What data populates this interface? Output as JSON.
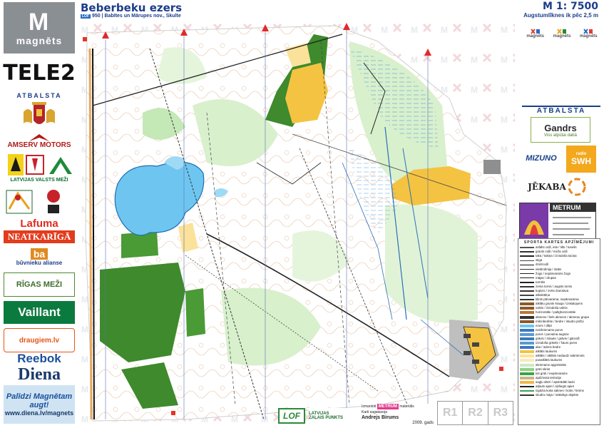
{
  "header": {
    "title": "Beberbeku ezers",
    "badge": "LOF",
    "subtitle": "950 | Babītes un Mārupes nov., Skulte",
    "scale": "M 1: 7500",
    "contour": "Augstumlīknes ik pēc 2,5 m"
  },
  "left_sponsors": {
    "magnets_mark": "M",
    "magnets_name": "magnēts",
    "tele2": "TELE2",
    "atbalsta": "ATBALSTA",
    "amserv": "AMSERV MOTORS",
    "lvm": "LATVIJAS VALSTS MEŽI",
    "lafuma": "Lafuma",
    "neatkariga": "NEATKARĪGĀ",
    "buvnieku_mark": "ba",
    "buvnieku": "būvnieku alianse",
    "rigas_mezi": "RĪGAS MEŽI",
    "vaillant": "Vaillant",
    "draugiem": "draugiem.lv",
    "reebok": "Reebok",
    "diena": "Diena",
    "palidzi": "Palīdzi Magnētam augt!",
    "palidzi_url": "www.diena.lv/magnets"
  },
  "right_sponsors": {
    "magnets_small": [
      "magnēts",
      "magnēts",
      "magnēts"
    ],
    "atbalsta": "ATBALSTA",
    "gandrs": "Gandrs",
    "gandrs_sub": "Viss atpūtai dabā",
    "mizuno": "MIZUNO",
    "swh": "SWH",
    "swh_radio": "radio",
    "jekaba": "JĒKABA",
    "metrum": "METRUM"
  },
  "legend": {
    "title": "SPORTA KARTES APZĪMĒJUMI",
    "items": [
      {
        "label": "asfalts ceļš, iela / tilts / tunelis",
        "color": "#555555"
      },
      {
        "label": "grants ceļš / meža ceļš",
        "color": "#333333"
      },
      {
        "label": "taka / takiņa / izzūdoša taciņa",
        "color": "#222222"
      },
      {
        "label": "stiga",
        "color": "#444444"
      },
      {
        "label": "dzelzceļš",
        "color": "#111111"
      },
      {
        "label": "elektrolīnija / stabs",
        "color": "#333333"
      },
      {
        "label": "žogs / nepārvarams žogs",
        "color": "#222222"
      },
      {
        "label": "mājas / drupas",
        "color": "#222222"
      },
      {
        "label": "tornītis",
        "color": "#222222"
      },
      {
        "label": "zema tornis / augsts tornis",
        "color": "#333333"
      },
      {
        "label": "kupicis / zvēru barotava",
        "color": "#333333"
      },
      {
        "label": "atbalsttiņa",
        "color": "#444444"
      },
      {
        "label": "klints pārvarama, nepārvarama",
        "color": "#333333"
      },
      {
        "label": "atklātu grunts krauja / izskalojums",
        "color": "#8a5a2a"
      },
      {
        "label": "valnis / izzūdoša valnis",
        "color": "#8a5a2a"
      },
      {
        "label": "horizontāle / palīghorizontāle",
        "color": "#b8763a"
      },
      {
        "label": "akmens / liels akmens / akmeņu grupa",
        "color": "#333333"
      },
      {
        "label": "mikrobedrite / bedre / skudru pūžņi",
        "color": "#8a5a2a"
      },
      {
        "label": "ezers / dīķis",
        "color": "#6ec6f0"
      },
      {
        "label": "neizbrienams purvs",
        "color": "#3a7ac0"
      },
      {
        "label": "purvs / purvaina augsne",
        "color": "#5a9ad0"
      },
      {
        "label": "grāvis / strauts / grāvis / gārceļš",
        "color": "#3a7ac0"
      },
      {
        "label": "izzūdoša grāvīte / šaurs purvs",
        "color": "#5a9ad0"
      },
      {
        "label": "aka / ūdens bedre",
        "color": "#3a7ac0"
      },
      {
        "label": "atklāts laukums",
        "color": "#f5c342"
      },
      {
        "label": "atklāts / atklāts nedaudz sakrūmots",
        "color": "#fbe29a"
      },
      {
        "label": "pusatklāts laukums",
        "color": "#fbe9b8"
      },
      {
        "label": "skrienams apgrūtināts",
        "color": "#c8ecc0"
      },
      {
        "label": "grūti skriet",
        "color": "#8fd280"
      },
      {
        "label": "ļoti grūti / nepārvarams",
        "color": "#3da34a"
      },
      {
        "label": "apdzīvota teritorija",
        "color": "#c9b48a"
      },
      {
        "label": "augļu dārzi / apstrādāti lauki",
        "color": "#f2b84a"
      },
      {
        "label": "atļauts apiet / aizliegts apiet",
        "color": "#222222"
      },
      {
        "label": "izgāzta koka saknes / koks / krūms",
        "color": "#3da34a"
      },
      {
        "label": "skudru māja / mākslīgs objekts",
        "color": "#333333"
      }
    ]
  },
  "footer": {
    "lof": "LOF",
    "zalais_1": "LATVIJAS",
    "zalais_2": "ZAĻAIS PUNKTS",
    "izmantoti": "Izmantoti",
    "metrum": "METRUM",
    "materiali": "materiāls",
    "karti_sagatavoja": "Karti sagatavoja",
    "author": "Andrejs Birums",
    "year": "2009. gads"
  },
  "rboxes": [
    "R1",
    "R2",
    "R3"
  ]
}
